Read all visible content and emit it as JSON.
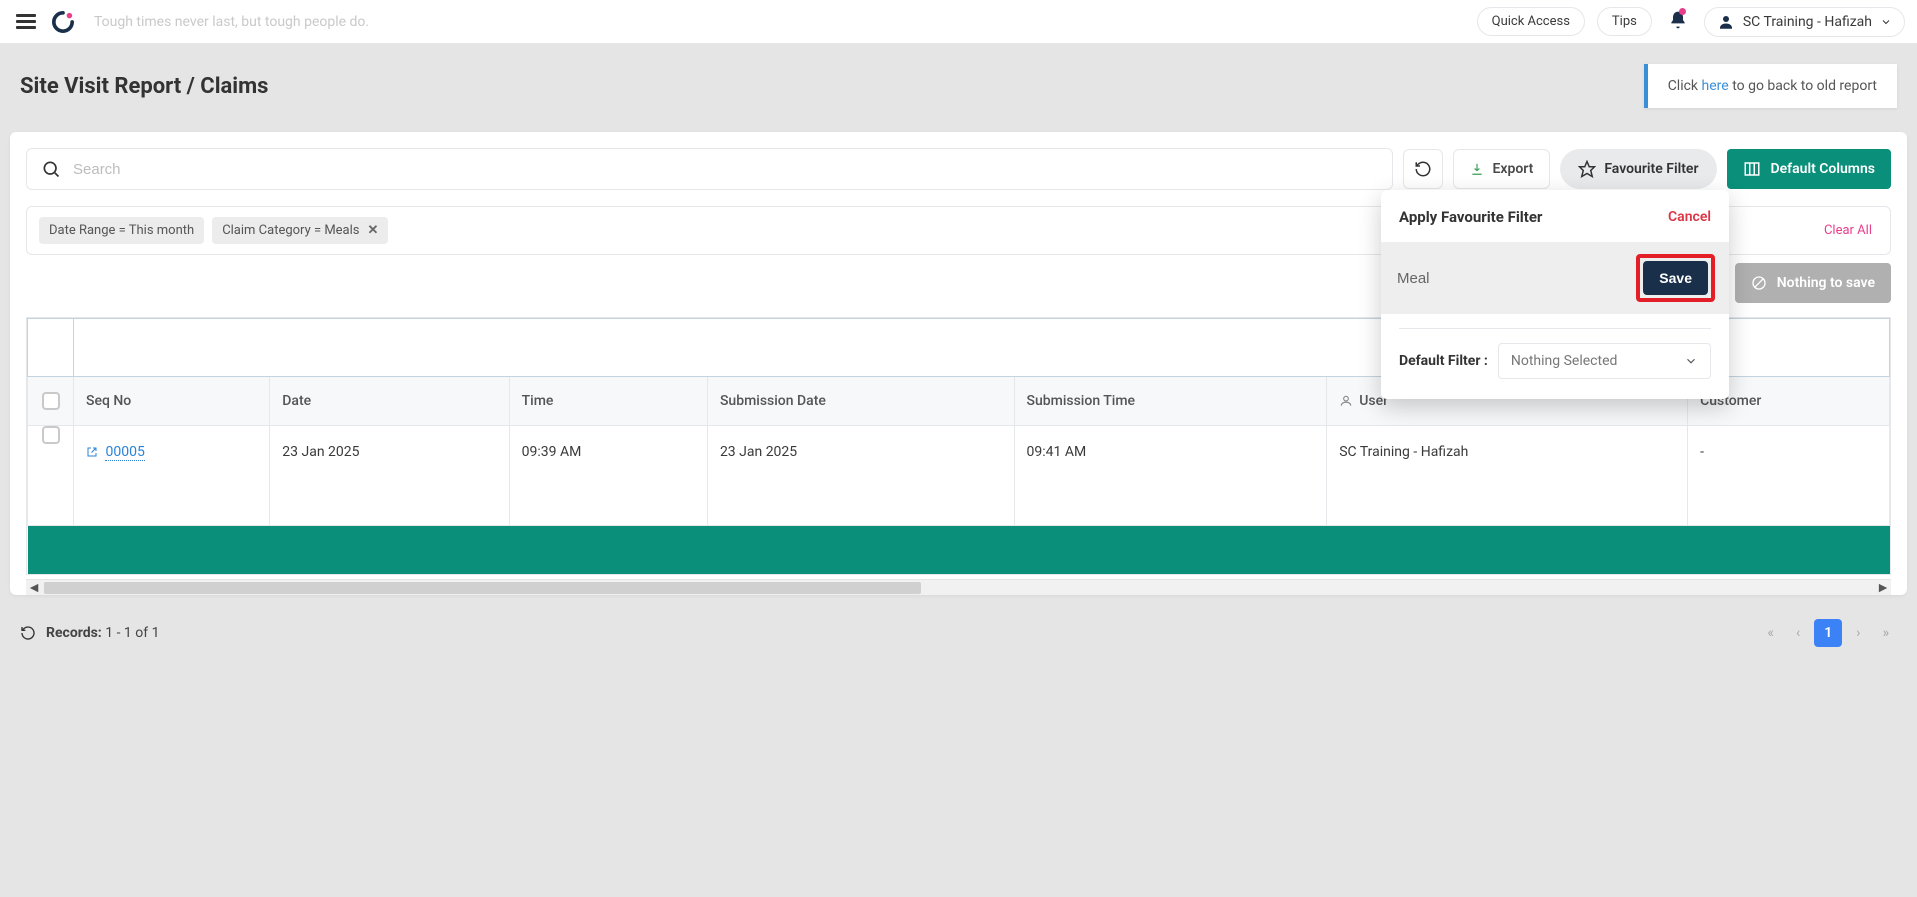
{
  "topbar": {
    "quote": "Tough times never last, but tough people do.",
    "quick_access": "Quick Access",
    "tips": "Tips",
    "user_name": "SC Training - Hafizah"
  },
  "page": {
    "title": "Site Visit Report / Claims",
    "back_notice_pre": "Click ",
    "back_notice_link": "here",
    "back_notice_post": " to go back to old report"
  },
  "toolbar": {
    "search_placeholder": "Search",
    "export_label": "Export",
    "favourite_label": "Favourite Filter",
    "default_cols_label": "Default Columns",
    "nothing_to_save": "Nothing to save"
  },
  "filters": {
    "chip1": "Date Range  =  This month",
    "chip2": "Claim Category  =  Meals",
    "clear_all": "Clear All"
  },
  "popover": {
    "title": "Apply Favourite Filter",
    "cancel": "Cancel",
    "input_value": "Meal",
    "save": "Save",
    "default_filter_label": "Default Filter :",
    "default_filter_value": "Nothing Selected"
  },
  "table": {
    "headers": {
      "seq": "Seq No",
      "date": "Date",
      "time": "Time",
      "sub_date": "Submission Date",
      "sub_time": "Submission Time",
      "user": "User",
      "customer": "Customer"
    },
    "rows": [
      {
        "seq": "00005",
        "date": "23 Jan 2025",
        "time": "09:39 AM",
        "sub_date": "23 Jan 2025",
        "sub_time": "09:41 AM",
        "user": "SC Training - Hafizah",
        "customer": "-"
      }
    ]
  },
  "footer": {
    "records_label": "Records:",
    "records_value": "1 - 1   of   1",
    "page": "1"
  }
}
